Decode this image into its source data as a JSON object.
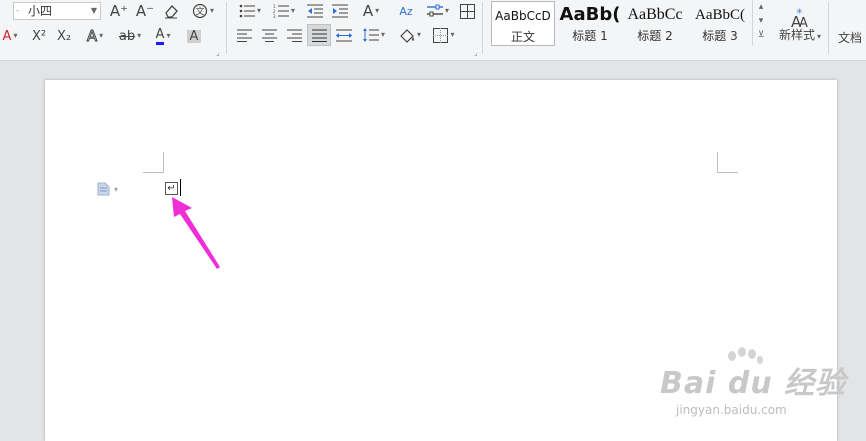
{
  "toolbar": {
    "font_size_value": "小四",
    "font_size_left_fragment": "-",
    "new_style_label": "新样式",
    "doc_tools_label": "文档",
    "glyphs": {
      "grow_font": "A⁺",
      "shrink_font": "A⁻",
      "clear_format": "◇",
      "phonetic": "㊦",
      "superscript": "X²",
      "subscript": "X₂",
      "text_effect": "A",
      "highlight": "ab",
      "font_color": "A",
      "char_shading": "A",
      "sort": "Az",
      "asian_layout": "A"
    }
  },
  "styles": [
    {
      "sample": "AaBbCcD",
      "name": "正文",
      "selected": true
    },
    {
      "sample": "AaBb(",
      "name": "标题 1",
      "selected": false
    },
    {
      "sample": "AaBbCc",
      "name": "标题 2",
      "selected": false
    },
    {
      "sample": "AaBbC(",
      "name": "标题 3",
      "selected": false
    }
  ],
  "document": {
    "paragraph_mark": "↵"
  },
  "watermark": {
    "brand": "Bai du 经验",
    "url": "jingyan.baidu.com"
  },
  "colors": {
    "arrow": "#f02ed8",
    "font_color_bar": "#1a1aff"
  }
}
